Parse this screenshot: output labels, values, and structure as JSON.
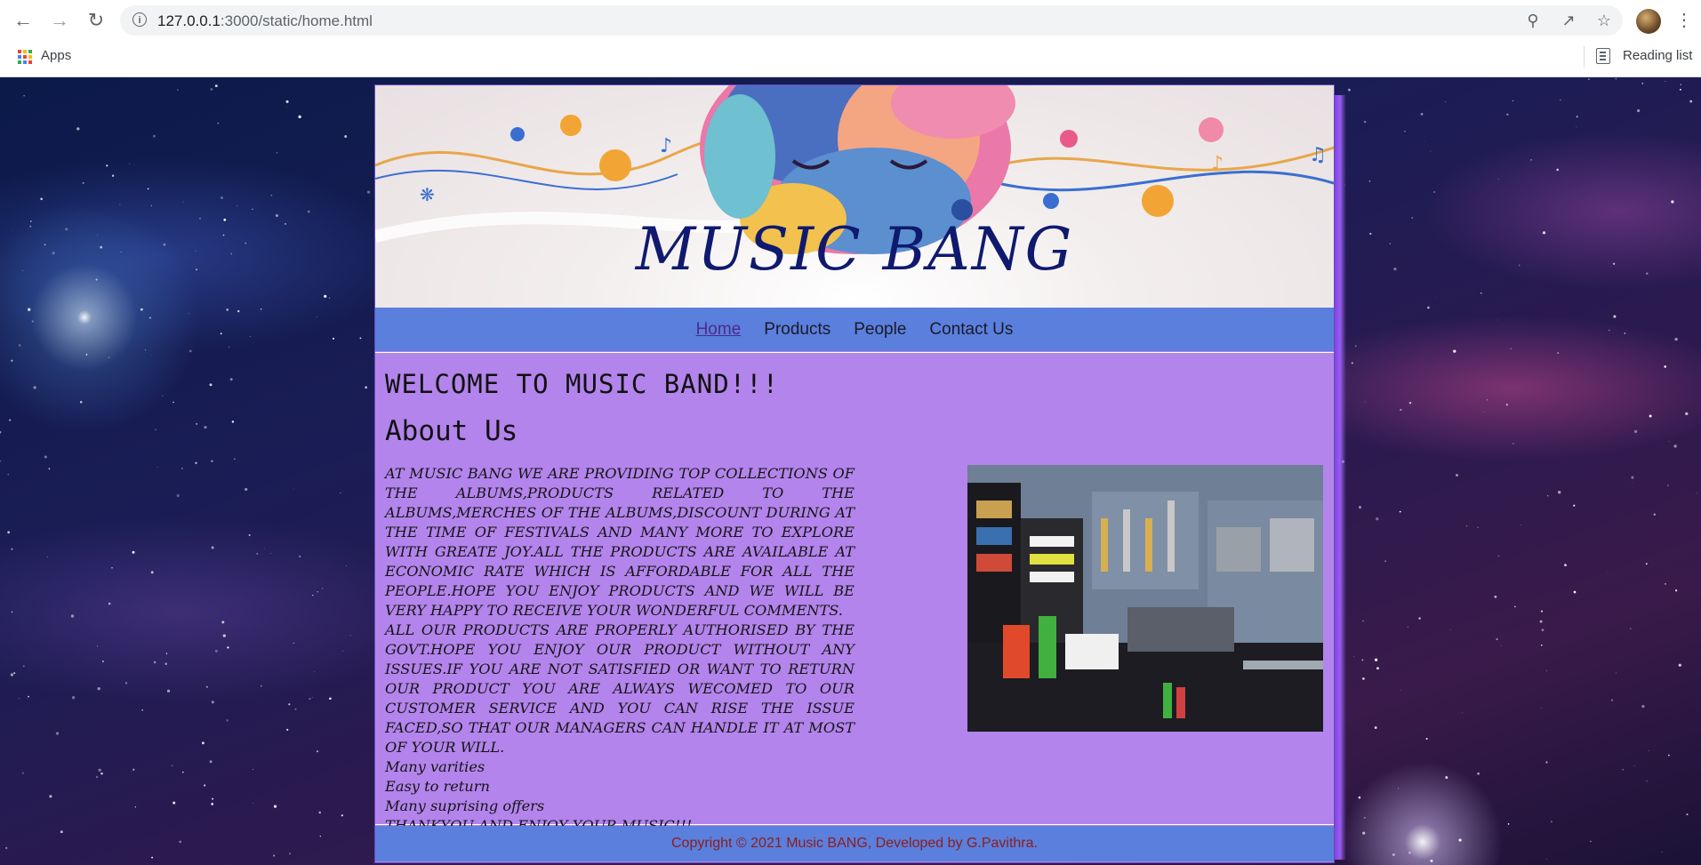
{
  "browser": {
    "url_host": "127.0.0.1",
    "url_rest": ":3000/static/home.html",
    "bookmarks_apps": "Apps",
    "reading_list": "Reading list"
  },
  "site": {
    "title": "MUSIC BANG",
    "nav": [
      {
        "label": "Home",
        "active": true
      },
      {
        "label": "Products",
        "active": false
      },
      {
        "label": "People",
        "active": false
      },
      {
        "label": "Contact Us",
        "active": false
      }
    ],
    "welcome_heading": "WELCOME TO MUSIC BAND!!!",
    "about_heading": "About Us",
    "paragraph1": "AT MUSIC BANG WE ARE PROVIDING TOP COLLECTIONS OF THE ALBUMS,PRODUCTS RELATED TO THE ALBUMS,MERCHES OF THE ALBUMS,DISCOUNT DURING AT THE TIME OF FESTIVALS AND MANY MORE TO EXPLORE WITH GREATE JOY.ALL THE PRODUCTS ARE AVAILABLE AT ECONOMIC RATE WHICH IS AFFORDABLE FOR ALL THE PEOPLE.HOPE YOU ENJOY PRODUCTS AND WE WILL BE VERY HAPPY TO RECEIVE YOUR WONDERFUL COMMENTS.",
    "paragraph2": "ALL OUR PRODUCTS ARE PROPERLY AUTHORISED BY THE GOVT.HOPE YOU ENJOY OUR PRODUCT WITHOUT ANY ISSUES.IF YOU ARE NOT SATISFIED OR WANT TO RETURN OUR PRODUCT YOU ARE ALWAYS WECOMED TO OUR CUSTOMER SERVICE AND YOU CAN RISE THE ISSUE FACED,SO THAT OUR MANAGERS CAN HANDLE IT AT MOST OF YOUR WILL.",
    "features": [
      "Many varities",
      "Easy to return",
      "Many suprising offers"
    ],
    "closing": "THANKYOU AND ENJOY YOUR MUSIC!!!",
    "footer": "Copyright © 2021 Music BANG, Developed by G.Pavithra."
  },
  "colors": {
    "navbar": "#5b7fdc",
    "content_bg": "#b384ec",
    "title": "#0f1a6e",
    "footer_text": "#8b1e1e"
  }
}
